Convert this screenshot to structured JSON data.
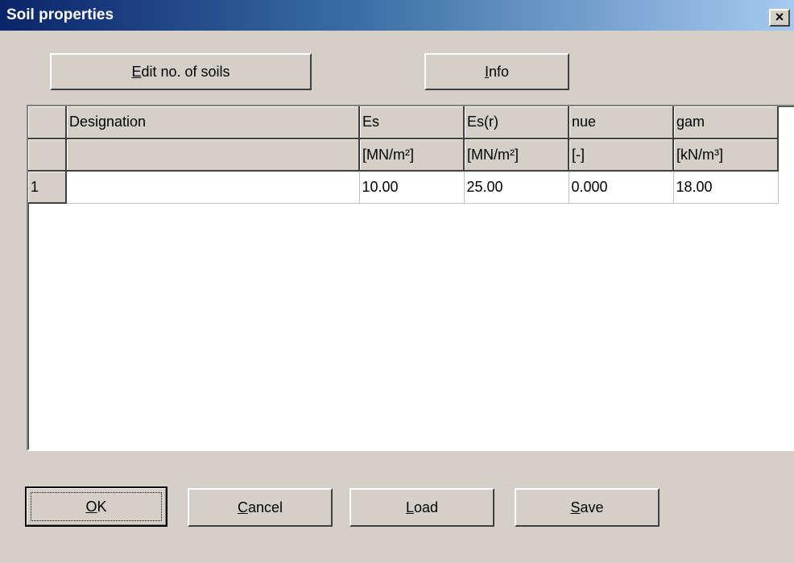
{
  "window": {
    "title": "Soil properties",
    "close_label": "×"
  },
  "toolbar": {
    "edit_soils": {
      "hotkey": "E",
      "rest": "dit no. of soils"
    },
    "info": {
      "hotkey": "I",
      "rest": "nfo"
    }
  },
  "table": {
    "columns": [
      {
        "name": "Designation",
        "unit": ""
      },
      {
        "name": "Es",
        "unit": "[MN/m²]"
      },
      {
        "name": "Es(r)",
        "unit": "[MN/m²]"
      },
      {
        "name": "nue",
        "unit": "[-]"
      },
      {
        "name": "gam",
        "unit": "[kN/m³]"
      }
    ],
    "rows": [
      {
        "index": "1",
        "designation": "",
        "es": "10.00",
        "es_r": "25.00",
        "nue": "0.000",
        "gam": "18.00"
      }
    ]
  },
  "footer": {
    "ok": {
      "hotkey": "O",
      "rest": "K"
    },
    "cancel": {
      "hotkey": "C",
      "rest": "ancel"
    },
    "load": {
      "hotkey": "L",
      "rest": "oad"
    },
    "save": {
      "hotkey": "S",
      "rest": "ave"
    }
  },
  "colors": {
    "face": "#d4d0c8",
    "title_start": "#0a246a",
    "title_end": "#a6caf0"
  }
}
